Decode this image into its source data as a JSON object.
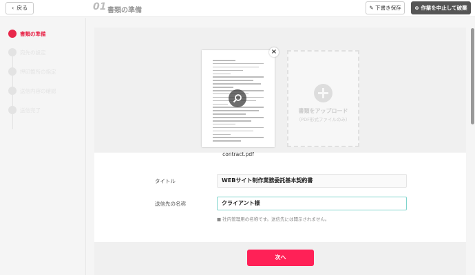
{
  "header": {
    "back_label": "戻る",
    "step_number": "01",
    "step_title": "書類の準備",
    "draft_label": "下書き保存",
    "abort_label": "作業を中止して破棄"
  },
  "sidebar": {
    "steps": [
      {
        "label": "書類の準備",
        "active": true
      },
      {
        "label": "宛先の設定",
        "active": false
      },
      {
        "label": "押印箇所の指定",
        "active": false
      },
      {
        "label": "送信内容の確認",
        "active": false
      },
      {
        "label": "送信完了",
        "active": false
      }
    ]
  },
  "document": {
    "filename": "contract.pdf"
  },
  "upload": {
    "label": "書類をアップロード",
    "sublabel": "（PDF形式ファイルのみ）"
  },
  "form": {
    "title_label": "タイトル",
    "title_value": "WEBサイト制作業務委託基本契約書",
    "recipient_label": "送信先の名称",
    "recipient_value": "クライアント様",
    "hint": "■ 社内管理用の名称です。送信先には開示されません。"
  },
  "footer": {
    "next_label": "次へ"
  },
  "colors": {
    "accent": "#e8284b",
    "button": "#ff2157",
    "focus_border": "#7fd4cc"
  }
}
